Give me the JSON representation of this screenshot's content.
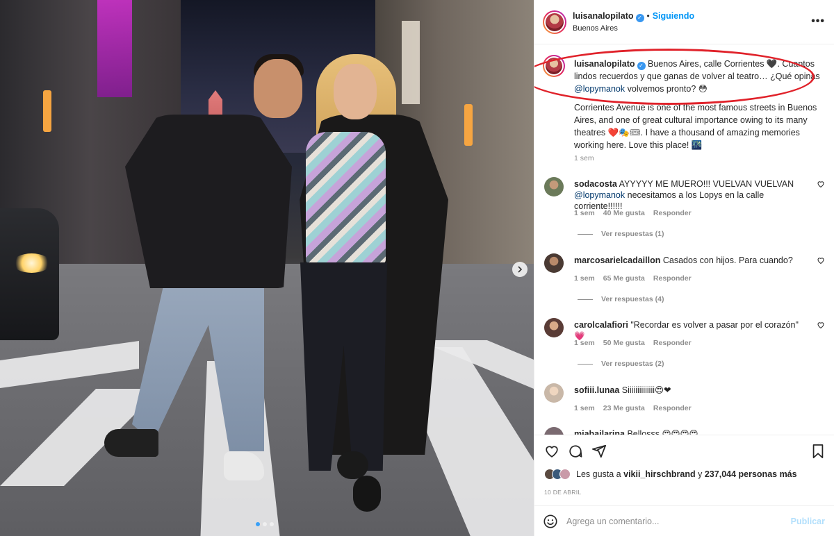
{
  "post": {
    "username": "luisanalopilato",
    "follow_label": "Siguiendo",
    "separator": "•",
    "location": "Buenos Aires",
    "more_label": "•••",
    "caption": {
      "username": "luisanalopilato",
      "text_start": "Buenos Aires, calle Corrientes 🖤. Cuantos lindos recuerdos y que ganas de volver al teatro… ¿Qué opinas ",
      "mention": "@lopymanok",
      "text_end": " volvemos pronto? 😳",
      "english": "Corrientes Avenue is one of the most famous streets in Buenos Aires, and one of great cultural importance owing to its many theatres ❤️🎭🎟. I have a thousand of amazing memories working here. Love this place! 🌃",
      "time": "1 sem"
    }
  },
  "comments": [
    {
      "username": "sodacosta",
      "text": "AYYYYY ME MUERO!!! VUELVAN VUELVAN ",
      "mention": "@lopymanok",
      "text_end": " necesitamos a los Lopys en la calle corriente!!!!!!",
      "time": "1 sem",
      "likes": "40 Me gusta",
      "reply": "Responder",
      "replies": "Ver respuestas (1)",
      "avatar_color": "#6b7a5a"
    },
    {
      "username": "marcosarielcadaillon",
      "text": "Casados con hijos. Para cuando?",
      "mention": "",
      "text_end": "",
      "time": "1 sem",
      "likes": "65 Me gusta",
      "reply": "Responder",
      "replies": "Ver respuestas (4)",
      "avatar_color": "#4a3a33"
    },
    {
      "username": "carolcalafiori",
      "text": "\"Recordar es volver a pasar por el corazón\" 💗",
      "mention": "",
      "text_end": "",
      "time": "1 sem",
      "likes": "50 Me gusta",
      "reply": "Responder",
      "replies": "Ver respuestas (2)",
      "avatar_color": "#5a3c36"
    },
    {
      "username": "sofiii.lunaa",
      "text": "Siiiiiiiiiiiiii😍❤",
      "mention": "",
      "text_end": "",
      "time": "1 sem",
      "likes": "23 Me gusta",
      "reply": "Responder",
      "replies": "",
      "avatar_color": "#c9b8a8"
    },
    {
      "username": "mjabailarina",
      "text": "Bellosss 😍😍😍😍",
      "mention": "",
      "text_end": "",
      "time": "",
      "likes": "",
      "reply": "",
      "replies": "",
      "avatar_color": "#7a6a70"
    }
  ],
  "actions": {
    "icons": [
      "heart-icon",
      "comment-icon",
      "share-icon",
      "bookmark-icon"
    ]
  },
  "likes": {
    "prefix": "Les gusta a",
    "user": "vikii_hirschbrand",
    "middle": "y",
    "count": "237,044 personas más"
  },
  "date": "10 DE ABRIL",
  "add_comment": {
    "placeholder": "Agrega un comentario...",
    "publish": "Publicar"
  },
  "colors": {
    "link": "#0095f6",
    "mention": "#00376b",
    "highlight_oval": "#e0222a",
    "muted": "#8e8e8e"
  }
}
